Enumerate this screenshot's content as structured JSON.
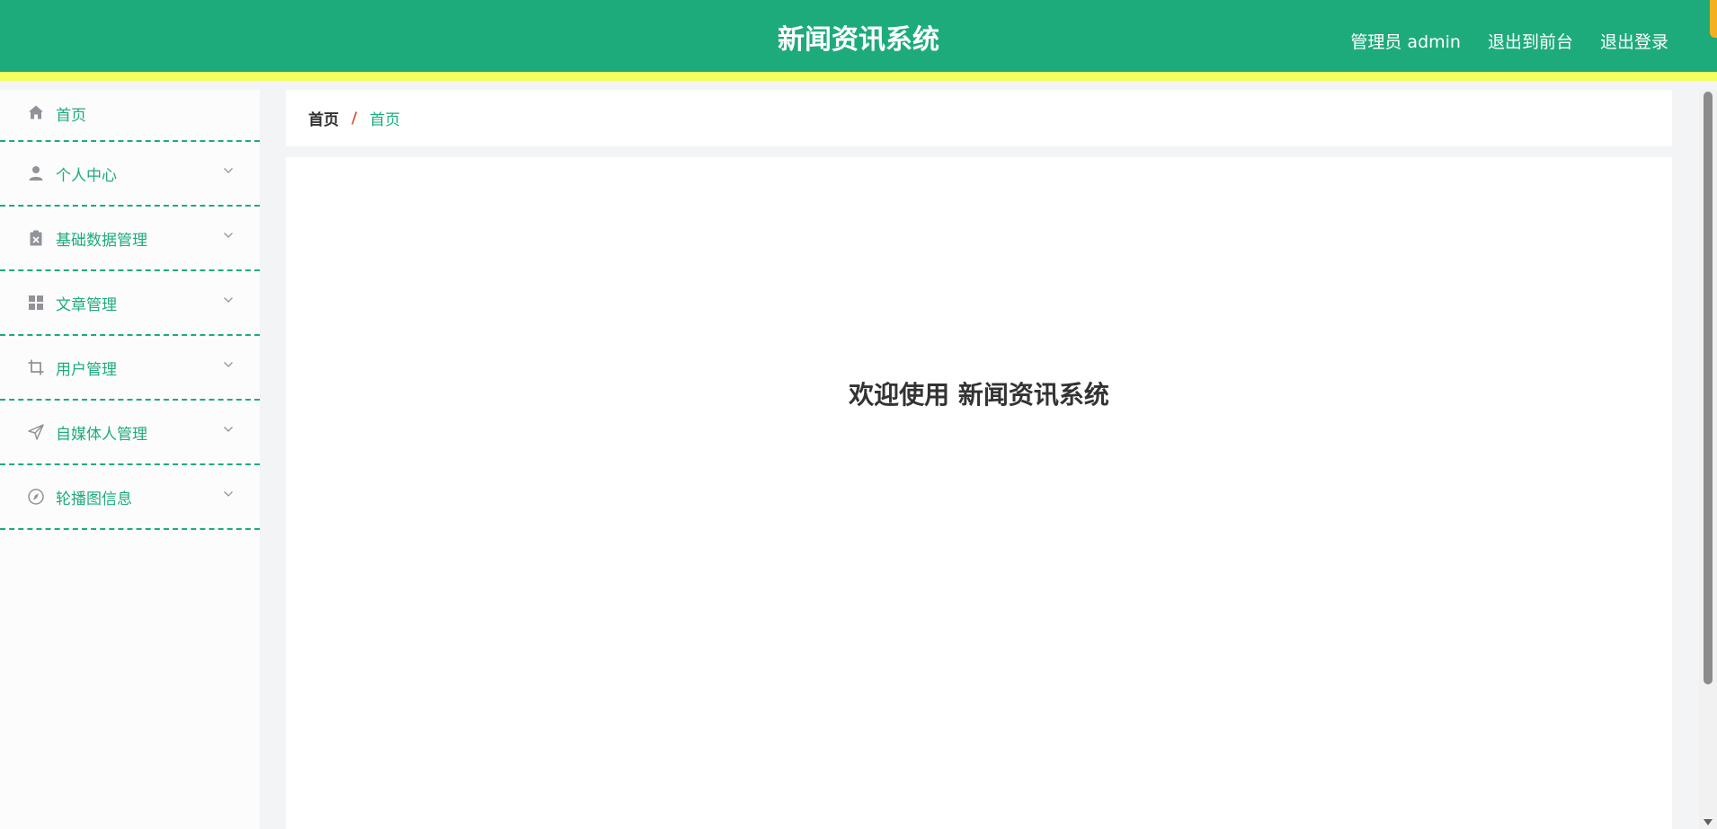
{
  "header": {
    "title": "新闻资讯系统",
    "user_label": "管理员 admin",
    "frontend_link": "退出到前台",
    "logout_link": "退出登录"
  },
  "sidebar": {
    "items": [
      {
        "label": "首页",
        "icon": "home-icon"
      },
      {
        "label": "个人中心",
        "icon": "user-icon"
      },
      {
        "label": "基础数据管理",
        "icon": "clipboard-icon"
      },
      {
        "label": "文章管理",
        "icon": "grid-icon"
      },
      {
        "label": "用户管理",
        "icon": "crop-icon"
      },
      {
        "label": "自媒体人管理",
        "icon": "send-icon"
      },
      {
        "label": "轮播图信息",
        "icon": "compass-icon"
      }
    ]
  },
  "breadcrumb": {
    "root": "首页",
    "separator": "/",
    "current": "首页"
  },
  "main": {
    "welcome": "欢迎使用 新闻资讯系统"
  },
  "colors": {
    "primary": "#1eab7b",
    "header_border": "#f5ff5e",
    "separator": "#e2573e"
  }
}
